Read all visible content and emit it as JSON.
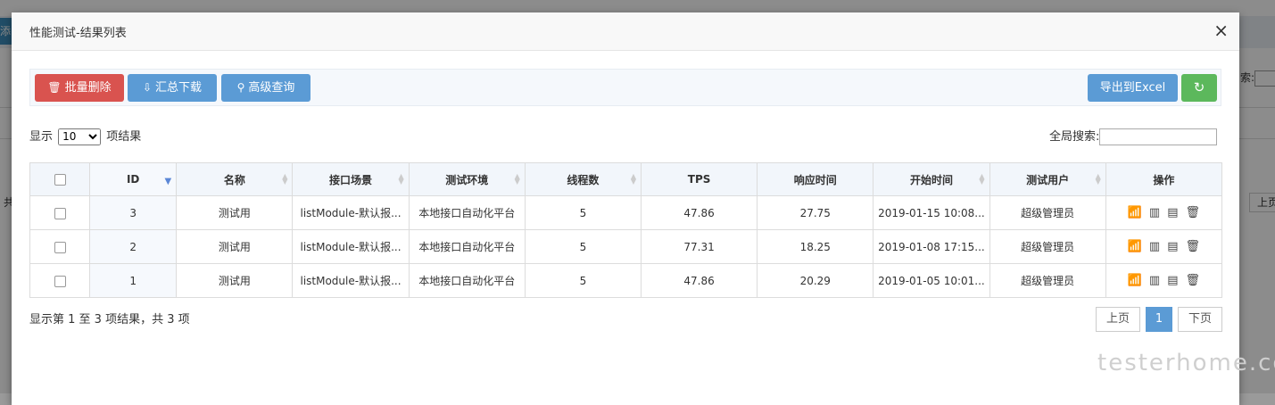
{
  "background": {
    "left_tab": "添",
    "search_label": "索:",
    "left_text": "共",
    "right_btn": "上页"
  },
  "modal": {
    "title": "性能测试-结果列表",
    "close": "×"
  },
  "toolbar": {
    "batch_delete": "批量删除",
    "download": "汇总下载",
    "advanced_query": "高级查询",
    "export_excel": "导出到Excel",
    "refresh_icon": "↻"
  },
  "length": {
    "prefix": "显示",
    "value": "10",
    "suffix": "项结果"
  },
  "filter": {
    "label": "全局搜索:"
  },
  "table": {
    "headers": [
      "ID",
      "名称",
      "接口场景",
      "测试环境",
      "线程数",
      "TPS",
      "响应时间",
      "开始时间",
      "测试用户",
      "操作"
    ],
    "rows": [
      {
        "id": "3",
        "name": "测试用",
        "scene": "listModule-默认报...",
        "env": "本地接口自动化平台",
        "threads": "5",
        "tps": "47.86",
        "resp": "27.75",
        "start": "2019-01-15 10:08...",
        "user": "超级管理员"
      },
      {
        "id": "2",
        "name": "测试用",
        "scene": "listModule-默认报...",
        "env": "本地接口自动化平台",
        "threads": "5",
        "tps": "77.31",
        "resp": "18.25",
        "start": "2019-01-08 17:15...",
        "user": "超级管理员"
      },
      {
        "id": "1",
        "name": "测试用",
        "scene": "listModule-默认报...",
        "env": "本地接口自动化平台",
        "threads": "5",
        "tps": "47.86",
        "resp": "20.29",
        "start": "2019-01-05 10:01...",
        "user": "超级管理员"
      }
    ]
  },
  "info": "显示第 1 至 3 项结果，共 3 项",
  "pager": {
    "prev": "上页",
    "current": "1",
    "next": "下页"
  },
  "watermark": "testerhome.com"
}
